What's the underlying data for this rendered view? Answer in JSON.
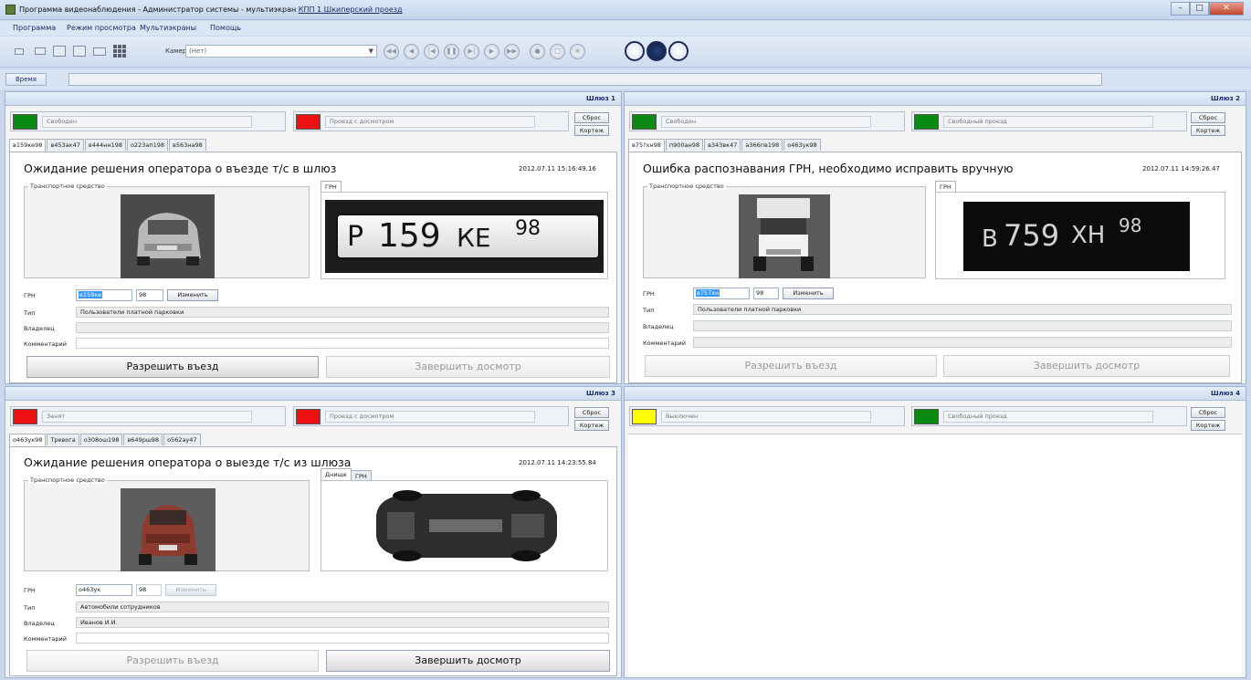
{
  "window": {
    "title_main": "Программа видеонаблюдения  - Администратор системы - мультиэкран",
    "title_link": "КПП 1 Шкиперский проезд",
    "buttons": {
      "minimize": "–",
      "maximize": "□",
      "close": "✕"
    }
  },
  "menu": [
    "Программа",
    "Режим просмотра",
    "Мультиэкраны",
    "Помощь"
  ],
  "toolbar": {
    "camera_label": "Камера:",
    "camera_value": "(Нет)",
    "playback_glyphs": [
      "◀◀",
      "◀",
      "|◀",
      "❚❚",
      "▶|",
      "▶",
      "▶▶",
      "●",
      "□",
      "⊕"
    ]
  },
  "time": {
    "button": "Время",
    "value": ""
  },
  "common": {
    "reset": "Сброс",
    "convoy": "Кортеж",
    "field_grn": "ГРН",
    "field_type": "Тип",
    "field_owner": "Владелец",
    "field_comment": "Комментарий",
    "change": "Изменить",
    "vehicle_group": "Транспортное средство",
    "tab_grn": "ГРН",
    "tab_underbody": "Днище",
    "allow_entry": "Разрешить въезд",
    "finish_inspection": "Завершить досмотр"
  },
  "panels": [
    {
      "name": "Шлюз 1",
      "status1": {
        "color": "#0a8a12",
        "text": "Свободен"
      },
      "status2": {
        "color": "#ee1111",
        "text": "Проезд с досмотром"
      },
      "tabs": [
        "в159ке98",
        "в453ак47",
        "в444нн198",
        "о223ап198",
        "в563на98"
      ],
      "message": "Ожидание решения оператора о въезде т/с в шлюз",
      "timestamp": "2012.07.11 15:16:49.16",
      "plate_parts": [
        "Р",
        "159",
        "КЕ",
        "98"
      ],
      "grn": "в159ке",
      "region": "98",
      "type": "Пользователи платной парковки",
      "owner": "",
      "comment": ""
    },
    {
      "name": "Шлюз 2",
      "status1": {
        "color": "#0a8a12",
        "text": "Свободен"
      },
      "status2": {
        "color": "#0a8a12",
        "text": "Свободный проезд"
      },
      "tabs": [
        "в75?хн98",
        "п900ан98",
        "в343вк47",
        "а366пв198",
        "о463ук98"
      ],
      "message": "Ошибка распознавания ГРН, необходимо исправить вручную",
      "timestamp": "2012.07.11 14:59:26.47",
      "plate_parts": [
        "В",
        "759",
        "ХН",
        "98"
      ],
      "grn": "в757хн",
      "region": "98",
      "type": "Пользователи платной парковки",
      "owner": "",
      "comment": ""
    },
    {
      "name": "Шлюз 3",
      "status1": {
        "color": "#ee1111",
        "text": "Занят"
      },
      "status2": {
        "color": "#ee1111",
        "text": "Проезд с досмотром"
      },
      "tabs": [
        "о463ук98",
        "Тревога",
        "о308ош198",
        "в649рш98",
        "о562ау47"
      ],
      "message": "Ожидание решения оператора о выезде т/с из шлюза",
      "timestamp": "2012.07.11 14:23:55.84",
      "grn": "о463ук",
      "region": "98",
      "type": "Автомобили сотрудников",
      "owner": "Иванов И.И.",
      "comment": ""
    },
    {
      "name": "Шлюз 4",
      "status1": {
        "color": "#ffff00",
        "text": "Выключен"
      },
      "status2": {
        "color": "#0a8a12",
        "text": "Свободный проезд"
      }
    }
  ]
}
